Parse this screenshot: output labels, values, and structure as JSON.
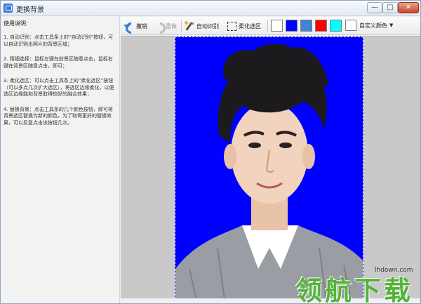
{
  "window": {
    "title": "更换背景",
    "min_label": "—",
    "max_label": "□",
    "close_label": "✕"
  },
  "help": {
    "title": "使用说明:",
    "steps": [
      "1. 自动识别：点击工具条上的“自动识别”按钮，可以自动识别出照片的背景区域；",
      "2. 精细选择：鼠标左键在前景区随意点击，鼠标右键在背景区随意点击，即可；",
      "3. 柔化选区：可以点击工具条上的“柔化选区”按钮（可以多点几次扩大选区），将选区边缘柔化，以便选区边缘能和背景取得较好的融合效果；",
      "4. 替换背景：点击工具条的几个颜色按钮，即可将背景选区替换为新的颜色，为了取得更好的替换效果，可以反复点击该按钮几次。"
    ]
  },
  "toolbar": {
    "undo_label": "撤销",
    "redo_label": "重做",
    "auto_detect_label": "自动识别",
    "soften_label": "柔化选区",
    "custom_color_label": "自定义颜色",
    "swatches": [
      "#ffffff",
      "#0000ff",
      "#3d85d8",
      "#ff0000",
      "#00ffff"
    ],
    "custom_swatch": "#ffffff"
  },
  "canvas": {
    "background_color": "#0000ff"
  },
  "watermark": {
    "url": "lhdown.com",
    "text": "领航下载"
  }
}
